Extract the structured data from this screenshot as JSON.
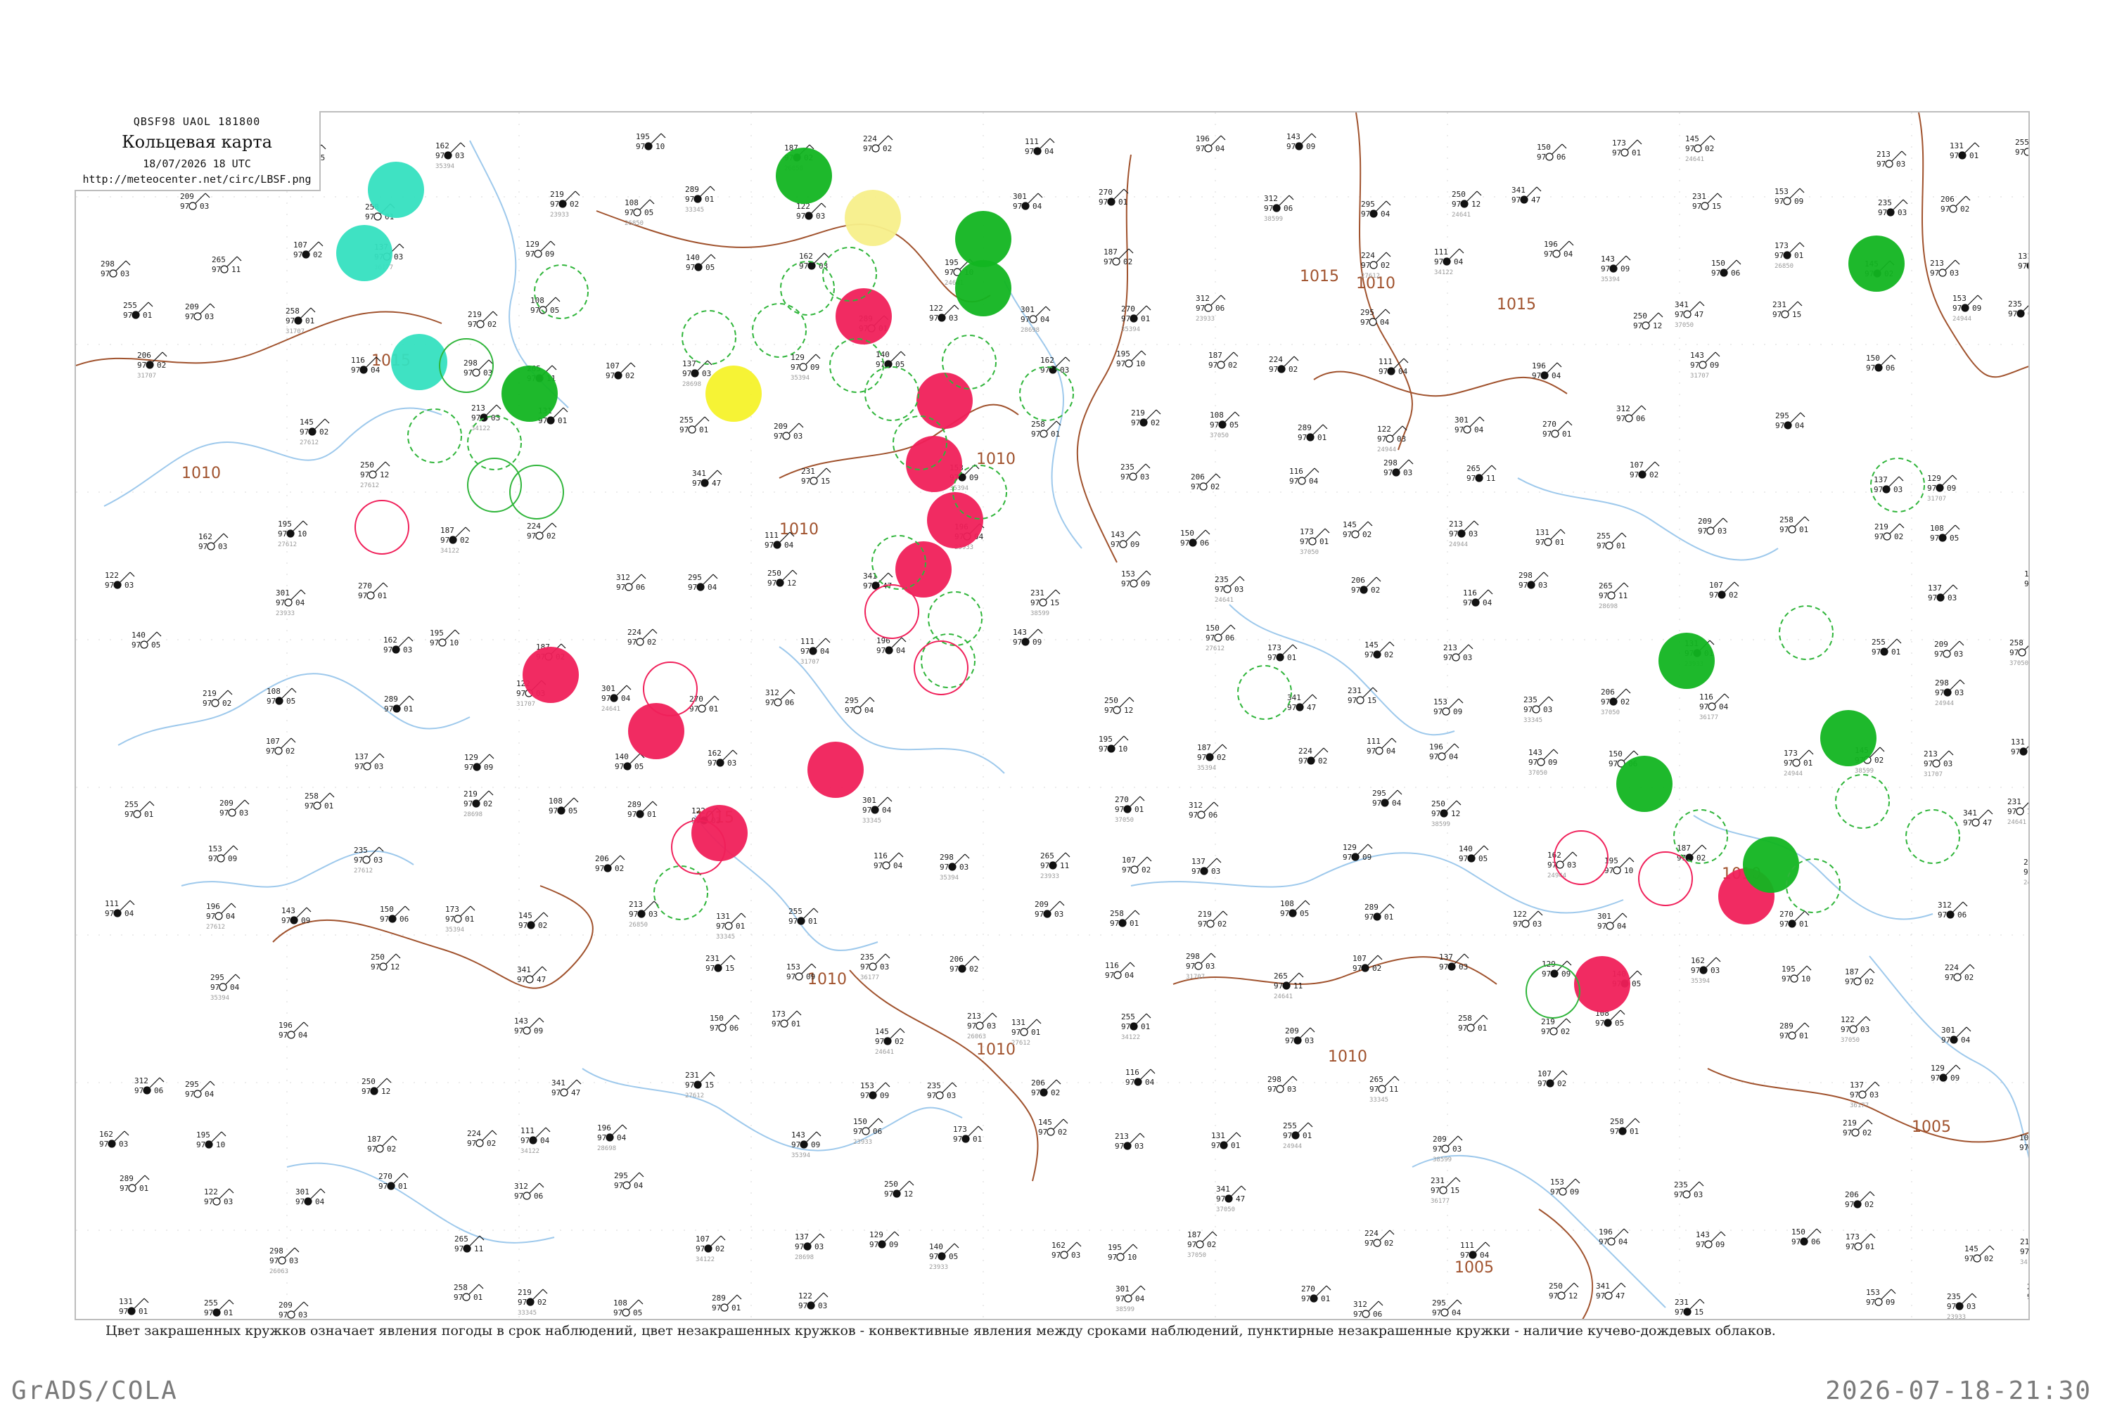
{
  "header": {
    "code_line": "QBSF98  UAOL  181800",
    "title": "Кольцевая карта",
    "date": "18/07/2026 18 UTC",
    "url": "http://meteocenter.net/circ/LBSF.png"
  },
  "legend_note": "Цвет закрашенных кружков означает явления погоды в срок наблюдений, цвет незакрашенных кружков - конвективные явления между сроками наблюдений, пунктирные незакрашенные кружки - наличие кучево-дождевых облаков.",
  "footer": {
    "left": "GrADS/COLA",
    "right": "2026-07-18-21:30"
  },
  "colors": {
    "isobar": "#a0522d",
    "coast": "#9ec9ec",
    "rain_green": "#12b521",
    "thunder_red": "#f0205a",
    "shower_teal": "#35e0c0",
    "hail_yellow": "#f6f22a",
    "fog_pale_yellow": "#f7ef8a",
    "cb_dashed_green": "#2fb53a",
    "frame": "#bdbdbd"
  },
  "isobar_labels": [
    "1015",
    "1010",
    "1010",
    "1015",
    "1010",
    "1010",
    "1010",
    "1015",
    "1010",
    "1010",
    "1015",
    "1010",
    "1005",
    "1005"
  ],
  "stations": [
    {
      "t": "137",
      "p": "97",
      "d": "03"
    },
    {
      "t": "129",
      "p": "97",
      "d": "09"
    },
    {
      "t": "140",
      "p": "97",
      "d": "05"
    },
    {
      "t": "162",
      "p": "97",
      "d": "03"
    },
    {
      "t": "195",
      "p": "97",
      "d": "10"
    },
    {
      "t": "187",
      "p": "97",
      "d": "02"
    },
    {
      "t": "224",
      "p": "97",
      "d": "02"
    },
    {
      "t": "111",
      "p": "97",
      "d": "04"
    },
    {
      "t": "196",
      "p": "97",
      "d": "04"
    },
    {
      "t": "143",
      "p": "97",
      "d": "09"
    },
    {
      "t": "150",
      "p": "97",
      "d": "06"
    },
    {
      "t": "173",
      "p": "97",
      "d": "01"
    },
    {
      "t": "145",
      "p": "97",
      "d": "02"
    },
    {
      "t": "213",
      "p": "97",
      "d": "03"
    },
    {
      "t": "131",
      "p": "97",
      "d": "01"
    },
    {
      "t": "255",
      "p": "97",
      "d": "01"
    },
    {
      "t": "209",
      "p": "97",
      "d": "03"
    },
    {
      "t": "258",
      "p": "97",
      "d": "01"
    },
    {
      "t": "219",
      "p": "97",
      "d": "02"
    },
    {
      "t": "108",
      "p": "97",
      "d": "05"
    },
    {
      "t": "289",
      "p": "97",
      "d": "01"
    },
    {
      "t": "122",
      "p": "97",
      "d": "03"
    },
    {
      "t": "301",
      "p": "97",
      "d": "04"
    },
    {
      "t": "270",
      "p": "97",
      "d": "01"
    },
    {
      "t": "312",
      "p": "97",
      "d": "06"
    },
    {
      "t": "295",
      "p": "97",
      "d": "04"
    },
    {
      "t": "250",
      "p": "97",
      "d": "12"
    },
    {
      "t": "341",
      "p": "97",
      "d": "47"
    },
    {
      "t": "231",
      "p": "97",
      "d": "15"
    },
    {
      "t": "153",
      "p": "97",
      "d": "09"
    },
    {
      "t": "235",
      "p": "97",
      "d": "03"
    },
    {
      "t": "206",
      "p": "97",
      "d": "02"
    },
    {
      "t": "116",
      "p": "97",
      "d": "04"
    },
    {
      "t": "298",
      "p": "97",
      "d": "03"
    },
    {
      "t": "265",
      "p": "97",
      "d": "11"
    },
    {
      "t": "107",
      "p": "97",
      "d": "02"
    }
  ],
  "station_ids": [
    "26063",
    "27612",
    "34122",
    "28698",
    "35394",
    "23933",
    "26850",
    "33345",
    "37050",
    "36177",
    "24944",
    "38599",
    "31707",
    "24641"
  ]
}
